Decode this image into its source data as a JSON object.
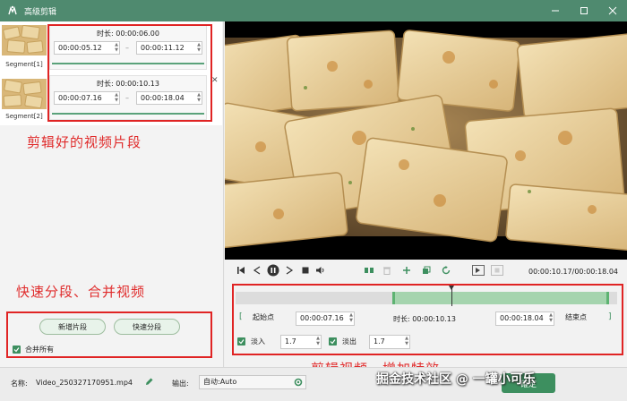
{
  "window": {
    "title": "高级剪辑"
  },
  "segments": [
    {
      "label": "Segment[1]",
      "duration_label": "时长:",
      "duration": "00:00:06.00",
      "start": "00:00:05.12",
      "end": "00:00:11.12"
    },
    {
      "label": "Segment[2]",
      "duration_label": "时长:",
      "duration": "00:00:10.13",
      "start": "00:00:07.16",
      "end": "00:00:18.04"
    }
  ],
  "annotations": {
    "segments_note": "剪辑好的视频片段",
    "split_note": "快速分段、合并视频",
    "edit_note": "剪辑视频、增加特效"
  },
  "left_buttons": {
    "add_segment": "新增片段",
    "quick_split": "快速分段",
    "merge_all": "合并所有"
  },
  "player": {
    "current_time": "00:00:10.17",
    "total_time": "00:00:18.04",
    "time_separator": "/"
  },
  "edit": {
    "start_btn": "起始点",
    "start": "00:00:07.16",
    "duration_label": "时长:",
    "duration": "00:00:10.13",
    "end": "00:00:18.04",
    "end_btn": "结束点",
    "fade_in_label": "淡入",
    "fade_in": "1.7",
    "fade_out_label": "淡出",
    "fade_out": "1.7",
    "selection": {
      "start_fraction": 0.41,
      "end_fraction": 0.98,
      "playhead_fraction": 0.565
    }
  },
  "bottom": {
    "name_label": "名称:",
    "name_value": "Video_250327170951.mp4",
    "output_label": "输出:",
    "output_value": "自动:Auto",
    "confirm": "確定"
  },
  "watermark": {
    "text": "掘金技术社区 @ 一罐小可乐"
  },
  "colors": {
    "accent": "#4f8a6f",
    "annotation": "#e02c2c",
    "selection": "#a5d4ae"
  }
}
